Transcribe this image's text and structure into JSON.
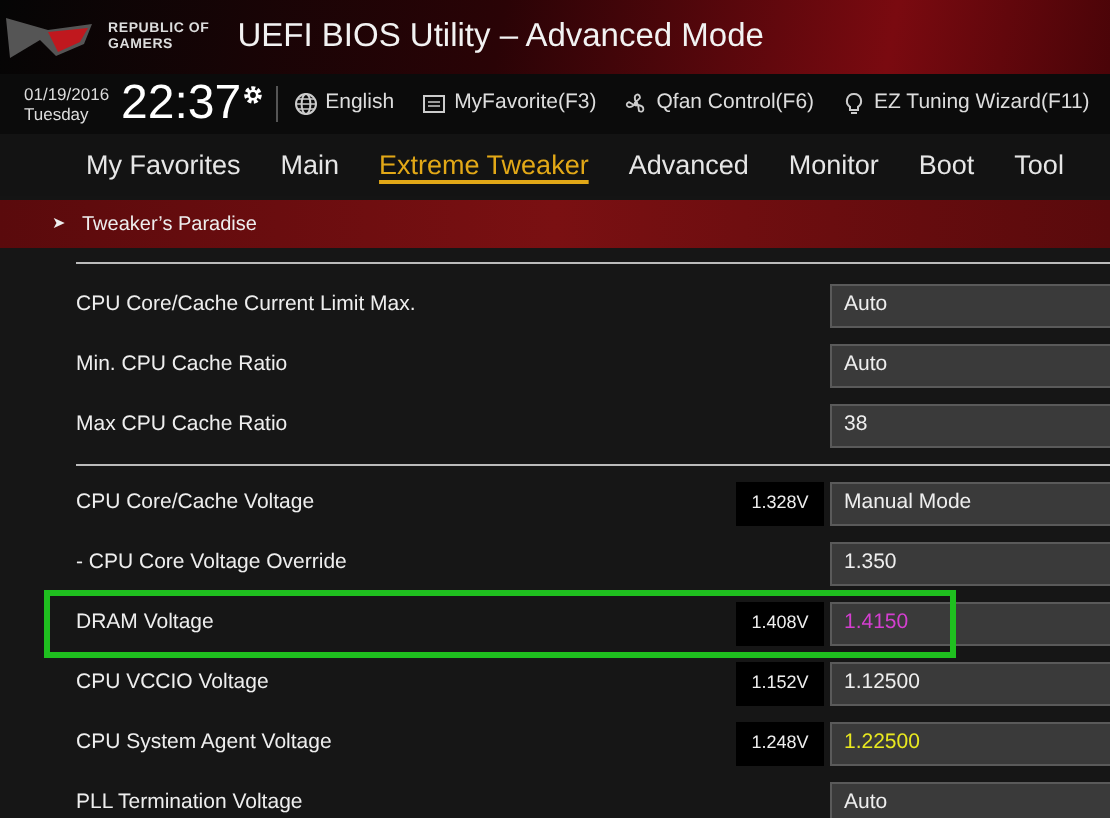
{
  "header": {
    "brand_line_1": "REPUBLIC OF",
    "brand_line_2": "GAMERS",
    "title": "UEFI BIOS Utility – Advanced Mode"
  },
  "toolbar": {
    "date": "01/19/2016",
    "weekday": "Tuesday",
    "time": "22:37",
    "items": [
      {
        "kind": "globe",
        "label": "English"
      },
      {
        "kind": "folder",
        "label": "MyFavorite(F3)"
      },
      {
        "kind": "fan",
        "label": "Qfan Control(F6)"
      },
      {
        "kind": "bulb",
        "label": "EZ Tuning Wizard(F11)"
      }
    ]
  },
  "tabs": [
    {
      "label": "My Favorites",
      "selected": false
    },
    {
      "label": "Main",
      "selected": false
    },
    {
      "label": "Extreme Tweaker",
      "selected": true
    },
    {
      "label": "Advanced",
      "selected": false
    },
    {
      "label": "Monitor",
      "selected": false
    },
    {
      "label": "Boot",
      "selected": false
    },
    {
      "label": "Tool",
      "selected": false
    }
  ],
  "breadcrumb": {
    "arrow": "➤",
    "label": "Tweaker’s Paradise"
  },
  "setting_groups": [
    {
      "rows": [
        {
          "label": "CPU Core/Cache Current Limit Max.",
          "value": "Auto",
          "highlighted": false
        },
        {
          "label": "Min. CPU Cache Ratio",
          "value": "Auto",
          "highlighted": false
        },
        {
          "label": "Max CPU Cache Ratio",
          "value": "38",
          "highlighted": false
        }
      ]
    },
    {
      "rows": [
        {
          "label": "CPU Core/Cache Voltage",
          "reading": "1.328V",
          "value": "Manual Mode",
          "highlighted": false
        },
        {
          "label": "- CPU Core Voltage Override",
          "value": "1.350",
          "highlighted": false
        },
        {
          "label": "DRAM Voltage",
          "reading": "1.408V",
          "value": "1.4150",
          "color": "#d43fd0",
          "highlighted": true
        },
        {
          "label": "CPU VCCIO Voltage",
          "reading": "1.152V",
          "value": "1.12500",
          "highlighted": false
        },
        {
          "label": "CPU System Agent Voltage",
          "reading": "1.248V",
          "value": "1.22500",
          "color": "#e8e820",
          "highlighted": false
        },
        {
          "label": "PLL Termination Voltage",
          "value": "Auto",
          "highlighted": false
        }
      ]
    }
  ]
}
